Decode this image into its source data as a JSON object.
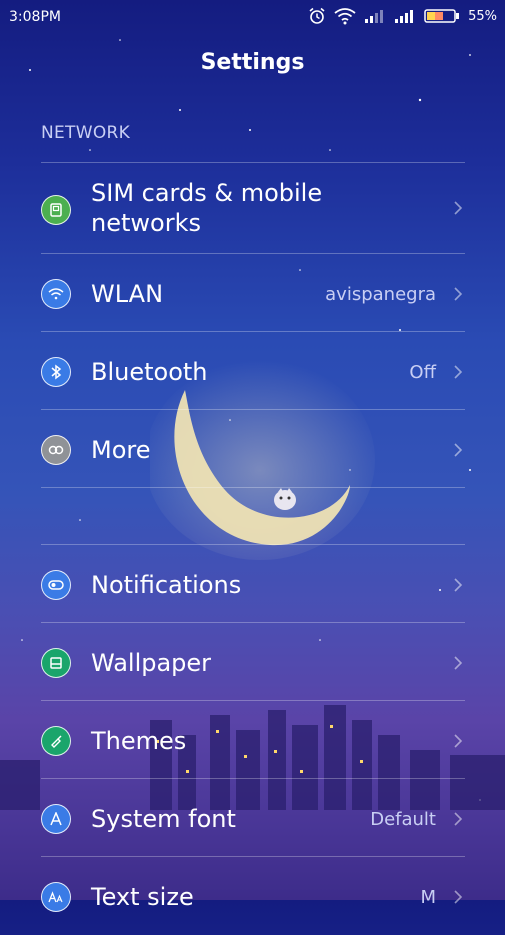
{
  "status": {
    "time": "3:08PM",
    "battery": "55%"
  },
  "header": {
    "title": "Settings"
  },
  "sections": {
    "network": "NETWORK"
  },
  "rows": {
    "sim": {
      "label": "SIM cards & mobile networks",
      "label_line1": "SIM cards & mobile",
      "label_line2": "networks",
      "value": ""
    },
    "wlan": {
      "label": "WLAN",
      "value": "avispanegra"
    },
    "bluetooth": {
      "label": "Bluetooth",
      "value": "Off"
    },
    "more": {
      "label": "More",
      "value": ""
    },
    "notifications": {
      "label": "Notifications",
      "value": ""
    },
    "wallpaper": {
      "label": "Wallpaper",
      "value": ""
    },
    "themes": {
      "label": "Themes",
      "value": ""
    },
    "system_font": {
      "label": "System font",
      "value": "Default"
    },
    "text_size": {
      "label": "Text size",
      "value": "M"
    }
  },
  "icons": {
    "alarm": "alarm-icon",
    "wifi": "wifi-icon",
    "signal": "signal-icon",
    "battery": "battery-icon",
    "sim": "sim-card-icon",
    "wlan": "wifi-icon",
    "bluetooth": "bluetooth-icon",
    "more": "link-icon",
    "notifications": "notification-icon",
    "wallpaper": "wallpaper-icon",
    "themes": "brush-icon",
    "system_font": "font-icon",
    "text_size": "text-size-icon",
    "chevron": "chevron-right-icon"
  },
  "colors": {
    "sim_icon": "#4caf50",
    "wlan_icon": "#3a7be6",
    "bluetooth_icon": "#3a7be6",
    "more_icon": "#8f9297",
    "notifications_icon": "#3a7be6",
    "wallpaper_icon": "#1aa56b",
    "themes_icon": "#1aa56b",
    "font_icon": "#3a7be6",
    "textsize_icon": "#3a7be6"
  }
}
